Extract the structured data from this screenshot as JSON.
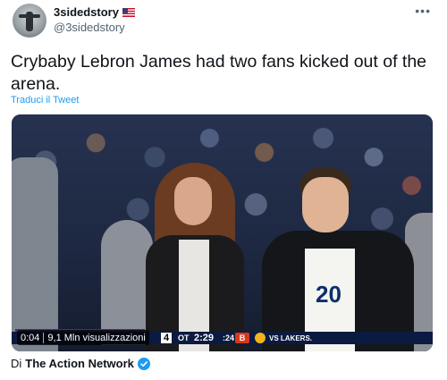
{
  "user": {
    "display_name": "3sidedstory",
    "handle": "@3sidedstory",
    "flag": "us-flag-icon"
  },
  "tweet": {
    "text": "Crybaby Lebron James had two fans kicked out of the arena.",
    "translate_label": "Traduci il Tweet"
  },
  "video": {
    "elapsed": "0:04",
    "views": "9,1 Mln visualizzazioni",
    "scoreboard": {
      "quarter": "4",
      "period": "OT",
      "clock": "2:29",
      "shot_clock": ":24",
      "matchup": "VS LAKERS."
    },
    "jersey_number": "20"
  },
  "source": {
    "prefix": "Di",
    "name": "The Action Network",
    "verified": true
  },
  "colors": {
    "link": "#1d9bf0",
    "secondary_text": "#536471",
    "verified": "#1d9bf0"
  }
}
